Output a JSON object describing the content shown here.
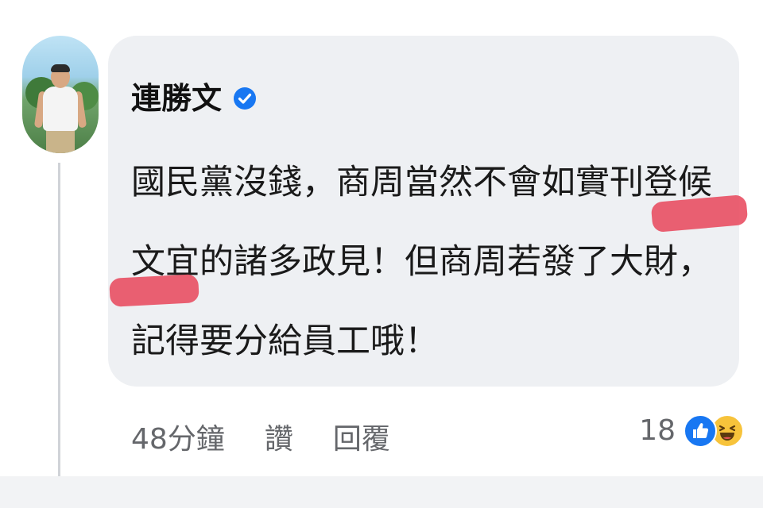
{
  "comment": {
    "author": "連勝文",
    "verified": true,
    "body_lines": [
      "國民黨沒錢，商周當然不會如實刊登候",
      "文宜的諸多政見！但商周若發了大財，",
      "記得要分給員工哦！"
    ]
  },
  "actions": {
    "time": "48分鐘",
    "like_label": "讚",
    "reply_label": "回覆"
  },
  "reactions": {
    "count": "18",
    "icons": [
      "like-icon",
      "haha-icon"
    ]
  },
  "colors": {
    "bubble_background": "#eef0f3",
    "verified_badge": "#1877f2",
    "like_reaction": "#1877f2",
    "haha_reaction": "#f7c33b",
    "highlight_marker": "#e84a5f",
    "secondary_text": "#65676b"
  }
}
